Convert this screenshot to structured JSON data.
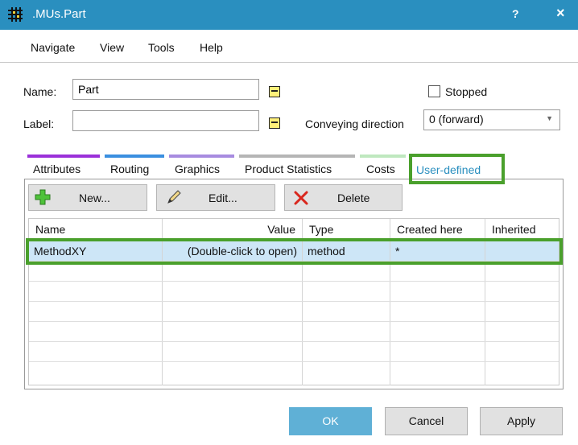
{
  "window": {
    "title": ".MUs.Part",
    "help": "?",
    "close": "×"
  },
  "menu": [
    "Navigate",
    "View",
    "Tools",
    "Help"
  ],
  "form": {
    "name_label": "Name:",
    "name_value": "Part",
    "label_label": "Label:",
    "label_value": "",
    "stopped_label": "Stopped",
    "stopped_checked": false,
    "conveying_label": "Conveying direction",
    "conveying_value": "0 (forward)"
  },
  "tabs": [
    {
      "label": "Attributes",
      "color": "#9b30d9"
    },
    {
      "label": "Routing",
      "color": "#3a8fe0"
    },
    {
      "label": "Graphics",
      "color": "#a78be0"
    },
    {
      "label": "Product Statistics",
      "color": "#b5b5b5"
    },
    {
      "label": "Costs",
      "color": "#bfe8bf"
    },
    {
      "label": "User-defined",
      "color": "#2a8fbf",
      "active": true
    }
  ],
  "toolbar": {
    "new": "New...",
    "edit": "Edit...",
    "delete": "Delete"
  },
  "table": {
    "columns": [
      "Name",
      "Value",
      "Type",
      "Created here",
      "Inherited"
    ],
    "rows": [
      [
        "MethodXY",
        "(Double-click to open)",
        "method",
        "*",
        ""
      ]
    ]
  },
  "buttons": {
    "ok": "OK",
    "cancel": "Cancel",
    "apply": "Apply"
  },
  "colors": {
    "title_bar": "#2a8fbf",
    "highlight": "#4aa02c",
    "selected_row": "#cde6f7",
    "ok_button": "#5fb0d6"
  }
}
